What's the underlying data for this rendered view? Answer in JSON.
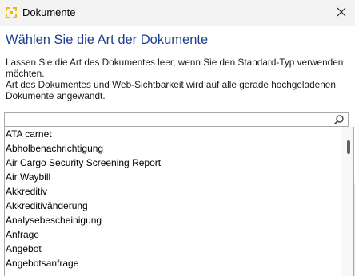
{
  "window": {
    "title": "Dokumente"
  },
  "dialog": {
    "heading": "Wählen Sie die Art der Dokumente",
    "description_1": "Lassen Sie die Art des Dokumentes leer, wenn Sie den Standard-Typ verwenden möchten.",
    "description_2": "Art des Dokumentes und Web-Sichtbarkeit wird auf alle gerade hochgeladenen Dokumente angewandt."
  },
  "search": {
    "value": "",
    "placeholder": ""
  },
  "document_types": [
    "ATA carnet",
    "Abholbenachrichtigung",
    "Air Cargo Security Screening Report",
    "Air Waybill",
    "Akkreditiv",
    "Akkreditivänderung",
    "Analysebescheinigung",
    "Anfrage",
    "Angebot",
    "Angebotsanfrage"
  ],
  "colors": {
    "heading": "#1f3f8f",
    "icon_yellow": "#f0b800"
  },
  "icons": {
    "app": "app-logo-icon",
    "close": "close-icon",
    "search": "search-icon"
  }
}
